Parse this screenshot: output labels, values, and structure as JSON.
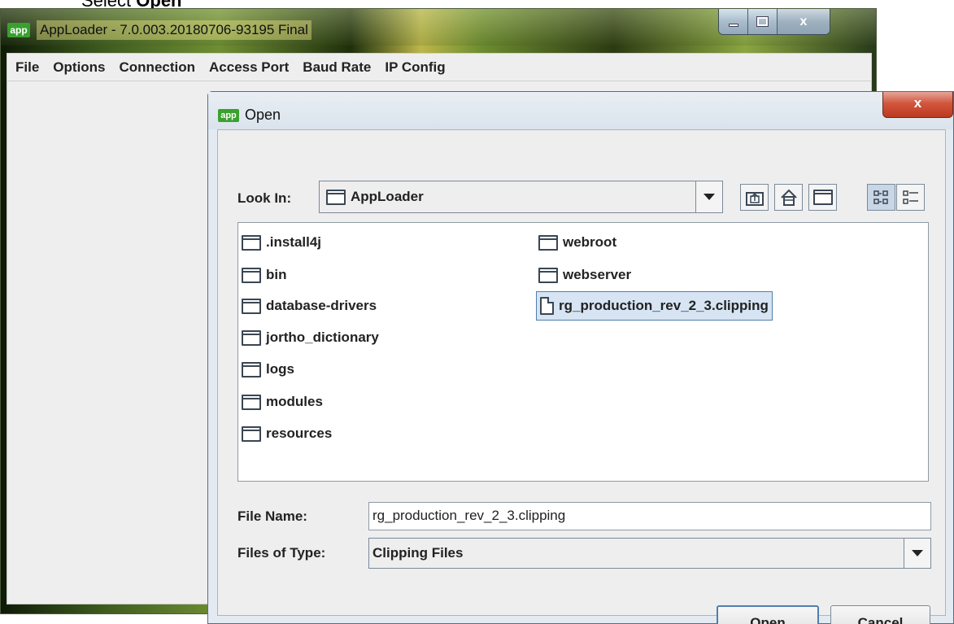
{
  "caption": {
    "prefix": "Select ",
    "bold": "Open"
  },
  "main_window": {
    "app_icon": "app",
    "title": "AppLoader - 7.0.003.20180706-93195 Final",
    "menu": [
      {
        "label": "File"
      },
      {
        "label": "Options"
      },
      {
        "label": "Connection"
      },
      {
        "label": "Access Port"
      },
      {
        "label": "Baud Rate"
      },
      {
        "label": "IP Config"
      }
    ],
    "controls": {
      "minimize": "minimize-icon",
      "maximize": "maximize-icon",
      "close": "x"
    }
  },
  "dialog": {
    "app_icon": "app",
    "title": "Open",
    "close": "x",
    "look_in_label": "Look In:",
    "look_in_value": "AppLoader",
    "toolbar": [
      {
        "name": "up-one-level-icon"
      },
      {
        "name": "home-icon"
      },
      {
        "name": "new-folder-icon"
      },
      {
        "name": "list-view-icon"
      },
      {
        "name": "details-view-icon"
      }
    ],
    "files_col1": [
      {
        "name": ".install4j",
        "type": "folder"
      },
      {
        "name": "bin",
        "type": "folder"
      },
      {
        "name": "database-drivers",
        "type": "folder"
      },
      {
        "name": "jortho_dictionary",
        "type": "folder"
      },
      {
        "name": "logs",
        "type": "folder"
      },
      {
        "name": "modules",
        "type": "folder"
      },
      {
        "name": "resources",
        "type": "folder"
      }
    ],
    "files_col2": [
      {
        "name": "webroot",
        "type": "folder"
      },
      {
        "name": "webserver",
        "type": "folder"
      },
      {
        "name": "rg_production_rev_2_3.clipping",
        "type": "file",
        "selected": true
      }
    ],
    "file_name_label": "File Name:",
    "file_name_value": "rg_production_rev_2_3.clipping",
    "file_type_label": "Files of Type:",
    "file_type_value": "Clipping Files",
    "open_button": "Open",
    "cancel_button": "Cancel"
  }
}
